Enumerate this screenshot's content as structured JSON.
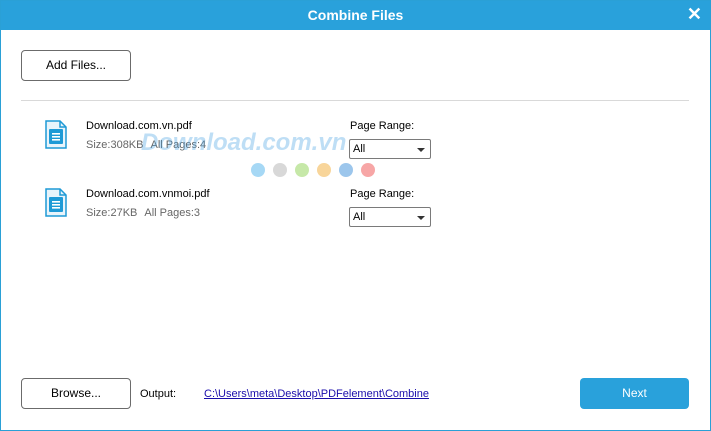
{
  "window": {
    "title": "Combine Files",
    "close_glyph": "✕"
  },
  "toolbar": {
    "add_files_label": "Add Files..."
  },
  "watermark": {
    "text": "Download.com.vn",
    "dot_colors": [
      "#a6d8f5",
      "#d8d8d8",
      "#c6e8a8",
      "#f8d59a",
      "#9cc6ec",
      "#f7a6a6"
    ]
  },
  "files": [
    {
      "name": "Download.com.vn.pdf",
      "size": "Size:308KB",
      "pages": "All Pages:4",
      "range_label": "Page Range:",
      "range_value": "All",
      "icon": "pdf-file-icon"
    },
    {
      "name": "Download.com.vnmoi.pdf",
      "size": "Size:27KB",
      "pages": "All Pages:3",
      "range_label": "Page Range:",
      "range_value": "All",
      "icon": "pdf-file-icon"
    }
  ],
  "footer": {
    "browse_label": "Browse...",
    "output_label": "Output:",
    "output_path": "C:\\Users\\meta\\Desktop\\PDFelement\\Combine",
    "next_label": "Next"
  },
  "colors": {
    "accent": "#29a1db",
    "icon_blue": "#1e9ad6"
  }
}
